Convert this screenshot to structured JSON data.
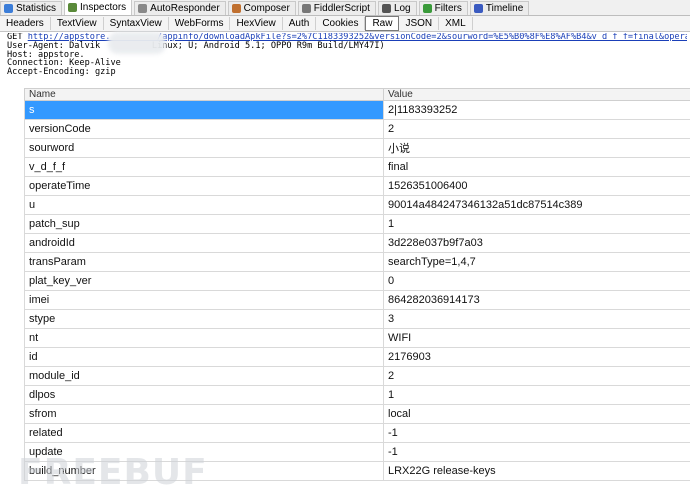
{
  "top_tabs": [
    {
      "label": "Statistics",
      "icon": "statistics-icon",
      "color": "#3b7dd8"
    },
    {
      "label": "Inspectors",
      "icon": "inspector-icon",
      "color": "#5a8a3a"
    },
    {
      "label": "AutoResponder",
      "icon": "lightning-icon",
      "color": "#888888"
    },
    {
      "label": "Composer",
      "icon": "composer-icon",
      "color": "#c07030"
    },
    {
      "label": "FiddlerScript",
      "icon": "script-icon",
      "color": "#777777"
    },
    {
      "label": "Log",
      "icon": "log-icon",
      "color": "#555555"
    },
    {
      "label": "Filters",
      "icon": "filter-check-icon",
      "color": "#3a9a3a"
    },
    {
      "label": "Timeline",
      "icon": "timeline-icon",
      "color": "#3a5ac0"
    }
  ],
  "sub_tabs": [
    "Headers",
    "TextView",
    "SyntaxView",
    "WebForms",
    "HexView",
    "Auth",
    "Cookies",
    "Raw",
    "JSON",
    "XML"
  ],
  "active_sub_tab": "Raw",
  "raw": {
    "get": "GET ",
    "url": "http://appstore.         /appinfo/downloadApkFile?s=2%7C1183393252&versionCode=2&sourword=%E5%B0%8F%E8%AF%B4&v_d_f_f=final&operat",
    "line2": "User-Agent: Dalvik          Linux; U; Android 5.1; OPPO R9m Build/LMY47I)",
    "line3": "Host: appstore.",
    "line4": "Connection: Keep-Alive",
    "line5": "Accept-Encoding: gzip"
  },
  "table": {
    "headers": [
      "Name",
      "Value"
    ],
    "rows": [
      [
        "s",
        "2|1183393252"
      ],
      [
        "versionCode",
        "2"
      ],
      [
        "sourword",
        "小说"
      ],
      [
        "v_d_f_f",
        "final"
      ],
      [
        "operateTime",
        "1526351006400"
      ],
      [
        "u",
        "90014a484247346132a51dc87514c389"
      ],
      [
        "patch_sup",
        "1"
      ],
      [
        "androidId",
        "3d228e037b9f7a03"
      ],
      [
        "transParam",
        "searchType=1,4,7"
      ],
      [
        "plat_key_ver",
        "0"
      ],
      [
        "imei",
        "864282036914173"
      ],
      [
        "stype",
        "3"
      ],
      [
        "nt",
        "WIFI"
      ],
      [
        "id",
        "2176903"
      ],
      [
        "module_id",
        "2"
      ],
      [
        "dlpos",
        "1"
      ],
      [
        "sfrom",
        "local"
      ],
      [
        "related",
        "-1"
      ],
      [
        "update",
        "-1"
      ],
      [
        "build_number",
        "LRX22G release-keys"
      ]
    ]
  },
  "watermark": "FREEBUF"
}
